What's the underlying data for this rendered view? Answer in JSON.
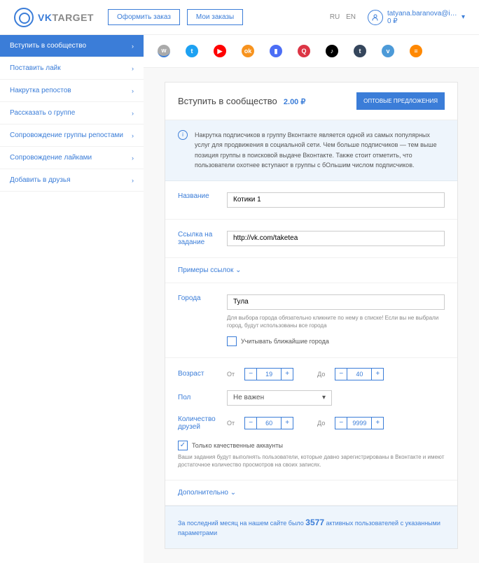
{
  "header": {
    "logo_1": "VK",
    "logo_2": "TARGET",
    "btn_order": "Оформить заказ",
    "btn_my_orders": "Мои заказы",
    "lang_ru": "RU",
    "lang_en": "EN",
    "user_name": "tatyana.baranova@ing...",
    "balance": "0 ₽"
  },
  "sidebar": {
    "items": [
      {
        "label": "Вступить в сообщество",
        "active": true
      },
      {
        "label": "Поставить лайк"
      },
      {
        "label": "Накрутка репостов"
      },
      {
        "label": "Рассказать о группе"
      },
      {
        "label": "Сопровождение группы репостами"
      },
      {
        "label": "Сопровождение лайками"
      },
      {
        "label": "Добавить в друзья"
      }
    ]
  },
  "card": {
    "title": "Вступить в сообщество",
    "price": "2.00 ₽",
    "wholesale": "ОПТОВЫЕ ПРЕДЛОЖЕНИЯ",
    "info": "Накрутка подписчиков в группу Вконтакте является одной из самых популярных услуг для продвижения в социальной сети. Чем больше подписчиков — тем выше позиция группы в поисковой выдаче Вконтакте. Также стоит отметить, что пользователи охотнее вступают в группы с бОльшим числом подписчиков."
  },
  "form": {
    "name_label": "Название",
    "name_value": "Котики 1",
    "link_label": "Ссылка на задание",
    "link_value": "http://vk.com/taketea",
    "examples": "Примеры ссылок",
    "city_label": "Города",
    "city_value": "Тула",
    "city_hint": "Для выбора города обязательно кликните по нему в списке! Если вы не выбрали город, будут использованы все города",
    "city_nearby": "Учитывать ближайшие города",
    "age_label": "Возраст",
    "from": "От",
    "to": "До",
    "age_from": "19",
    "age_to": "40",
    "gender_label": "Пол",
    "gender_value": "Не важен",
    "friends_label": "Количество друзей",
    "friends_from": "60",
    "friends_to": "9999",
    "quality": "Только качественные аккаунты",
    "quality_hint": "Ваши задания будут выполнять пользователи, которые давно зарегистрированы в Вконтакте и имеют достаточное количество просмотров на своих записях.",
    "additional": "Дополнительно"
  },
  "footer": {
    "t1": "За последний месяц на нашем сайте было ",
    "num": "3577",
    "t2": " активных пользователей с указанными параметрами"
  }
}
